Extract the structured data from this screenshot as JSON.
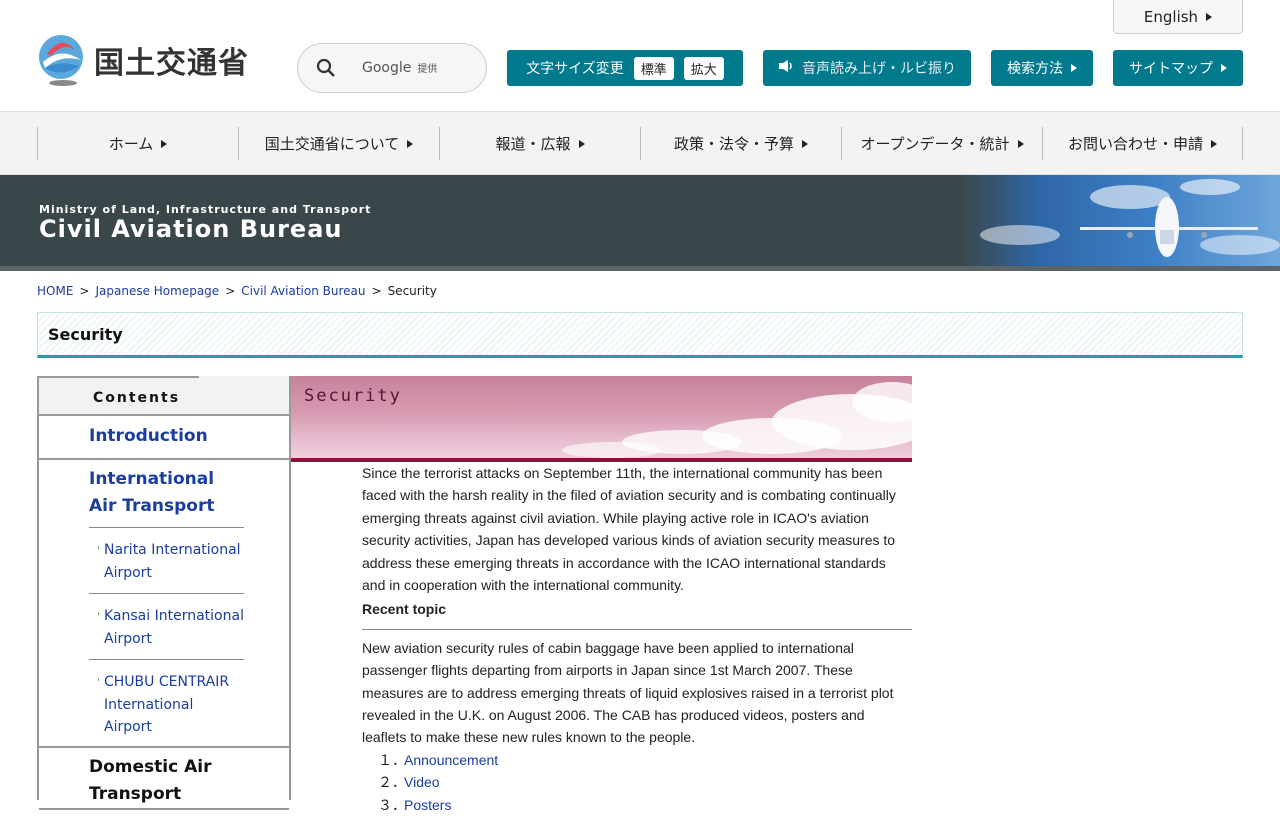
{
  "header": {
    "logo_text": "国土交通省",
    "english_label": "English",
    "search": {
      "brand": "Google",
      "provided": "提供"
    },
    "font_size": {
      "label": "文字サイズ変更",
      "standard": "標準",
      "large": "拡大"
    },
    "voice_label": "音声読み上げ・ルビ振り",
    "search_method_label": "検索方法",
    "sitemap_label": "サイトマップ"
  },
  "nav": {
    "items": [
      {
        "label": "ホーム"
      },
      {
        "label": "国土交通省について"
      },
      {
        "label": "報道・広報"
      },
      {
        "label": "政策・法令・予算"
      },
      {
        "label": "オープンデータ・統計"
      },
      {
        "label": "お問い合わせ・申請"
      }
    ]
  },
  "banner": {
    "subtitle": "Ministry of Land, Infrastructure and Transport",
    "title": "Civil Aviation Bureau"
  },
  "breadcrumb": {
    "home": "HOME",
    "japanese": "Japanese Homepage",
    "cab": "Civil Aviation Bureau",
    "current": "Security",
    "sep": ">"
  },
  "page_title": "Security",
  "side": {
    "heading": "Contents",
    "introduction": "Introduction",
    "international": "International Air Transport",
    "subs": [
      {
        "label": "Narita International Airport"
      },
      {
        "label": "Kansai International Airport"
      },
      {
        "label": "CHUBU CENTRAIR International Airport"
      }
    ],
    "domestic": "Domestic Air Transport"
  },
  "content": {
    "banner_label": "Security",
    "intro": "Since the terrorist attacks on September 11th, the international community has been faced with the harsh reality in the filed of aviation security and is combating continually emerging threats against civil aviation. While playing active role in ICAO's aviation security activities, Japan has developed various kinds of aviation security measures to address these emerging threats in accordance with the ICAO international standards and in cooperation with the international community.",
    "recent_heading": "Recent topic",
    "recent_body": "New aviation security rules of cabin baggage have been applied to international passenger flights departing from airports in Japan since 1st March 2007. These measures are to address emerging threats of liquid explosives raised in a terrorist plot revealed in the U.K. on August 2006. The CAB has produced videos, posters and leaflets to make these new rules known to the people.",
    "links": [
      {
        "num": "１．",
        "label": "Announcement"
      },
      {
        "num": "２．",
        "label": "Video"
      },
      {
        "num": "３．",
        "label": "Posters"
      }
    ]
  },
  "colors": {
    "teal": "#007a8c",
    "link": "#1a3d9e",
    "maroon": "#8e0f3b"
  }
}
